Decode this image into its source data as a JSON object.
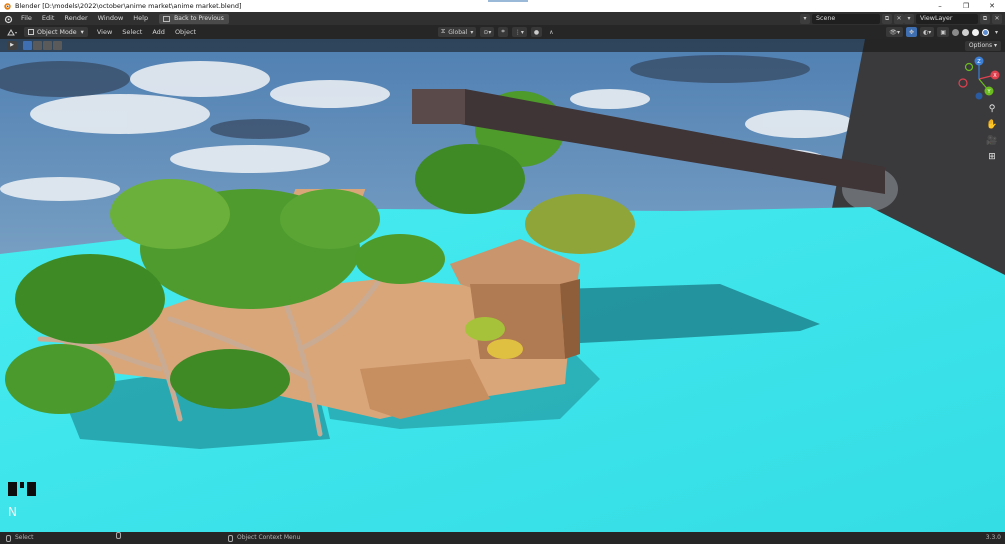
{
  "window": {
    "title": "Blender [D:\\models\\2022\\october\\anime market\\anime market.blend]",
    "controls": [
      "–",
      "❐",
      "✕"
    ]
  },
  "menubar": {
    "items": [
      "File",
      "Edit",
      "Render",
      "Window",
      "Help"
    ],
    "back_button": "Back to Previous",
    "scene": "Scene",
    "view_layer": "ViewLayer"
  },
  "header": {
    "mode": "Object Mode",
    "menus": [
      "View",
      "Select",
      "Add",
      "Object"
    ],
    "orientation": "Global"
  },
  "toolbar": {
    "options": "Options"
  },
  "viewport": {
    "gizmo_axes": [
      "X",
      "Y",
      "Z"
    ],
    "n_panel_key": "N",
    "colors": {
      "ground": "#3ee6ea",
      "sky": "#5d88b5",
      "wall": "#3a3a3c",
      "beam": "#3f3436",
      "wood": "#d9a67a",
      "foliage": "#4e9a2b"
    }
  },
  "statusbar": {
    "left": "Select",
    "middle": "Object Context Menu",
    "version": "3.3.0"
  }
}
